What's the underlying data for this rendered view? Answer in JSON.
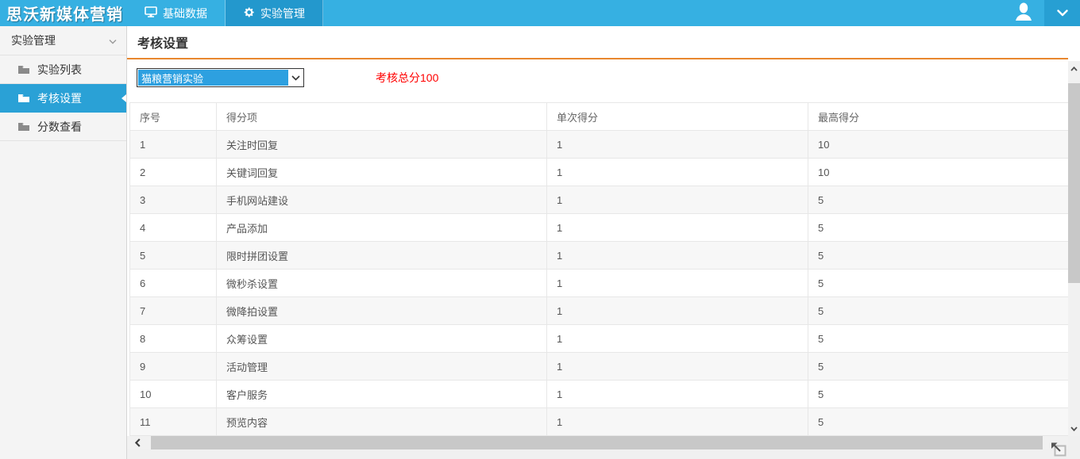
{
  "topbar": {
    "logo": "思沃新媒体营销",
    "tabs": [
      {
        "label": "基础数据",
        "icon": "monitor-icon",
        "active": false
      },
      {
        "label": "实验管理",
        "icon": "gear-icon",
        "active": true
      }
    ]
  },
  "sidebar": {
    "group_title": "实验管理",
    "items": [
      {
        "label": "实验列表",
        "active": false
      },
      {
        "label": "考核设置",
        "active": true
      },
      {
        "label": "分数查看",
        "active": false
      }
    ]
  },
  "main": {
    "page_title": "考核设置",
    "experiment_select": {
      "value": "猫粮营销实验"
    },
    "total_score_label": "考核总分100",
    "table": {
      "columns": [
        "序号",
        "得分项",
        "单次得分",
        "最高得分"
      ],
      "rows": [
        [
          "1",
          "关注时回复",
          "1",
          "10"
        ],
        [
          "2",
          "关键词回复",
          "1",
          "10"
        ],
        [
          "3",
          "手机网站建设",
          "1",
          "5"
        ],
        [
          "4",
          "产品添加",
          "1",
          "5"
        ],
        [
          "5",
          "限时拼团设置",
          "1",
          "5"
        ],
        [
          "6",
          "微秒杀设置",
          "1",
          "5"
        ],
        [
          "7",
          "微降拍设置",
          "1",
          "5"
        ],
        [
          "8",
          "众筹设置",
          "1",
          "5"
        ],
        [
          "9",
          "活动管理",
          "1",
          "5"
        ],
        [
          "10",
          "客户服务",
          "1",
          "5"
        ],
        [
          "11",
          "预览内容",
          "1",
          "5"
        ]
      ]
    }
  },
  "colors": {
    "topbar": "#36b0e2",
    "topbar_active_tab": "#2398cd",
    "sidebar_active": "#2aa1d6",
    "header_divider": "#e8872e",
    "total_score_text": "#ff0000",
    "select_highlight": "#2da0e0",
    "table_border": "#e7e7e7"
  }
}
